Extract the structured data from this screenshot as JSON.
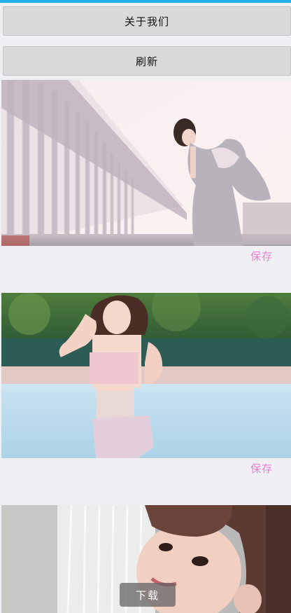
{
  "buttons": {
    "about": "关于我们",
    "refresh": "刷新"
  },
  "cards": [
    {
      "save": "保存"
    },
    {
      "save": "保存"
    },
    {
      "save": ""
    }
  ],
  "download": "下载",
  "colors": {
    "accent_top": "#21b3e8",
    "save_text": "#f07ed1",
    "button_bg": "#d8dadb",
    "page_bg": "#f0eff4"
  }
}
